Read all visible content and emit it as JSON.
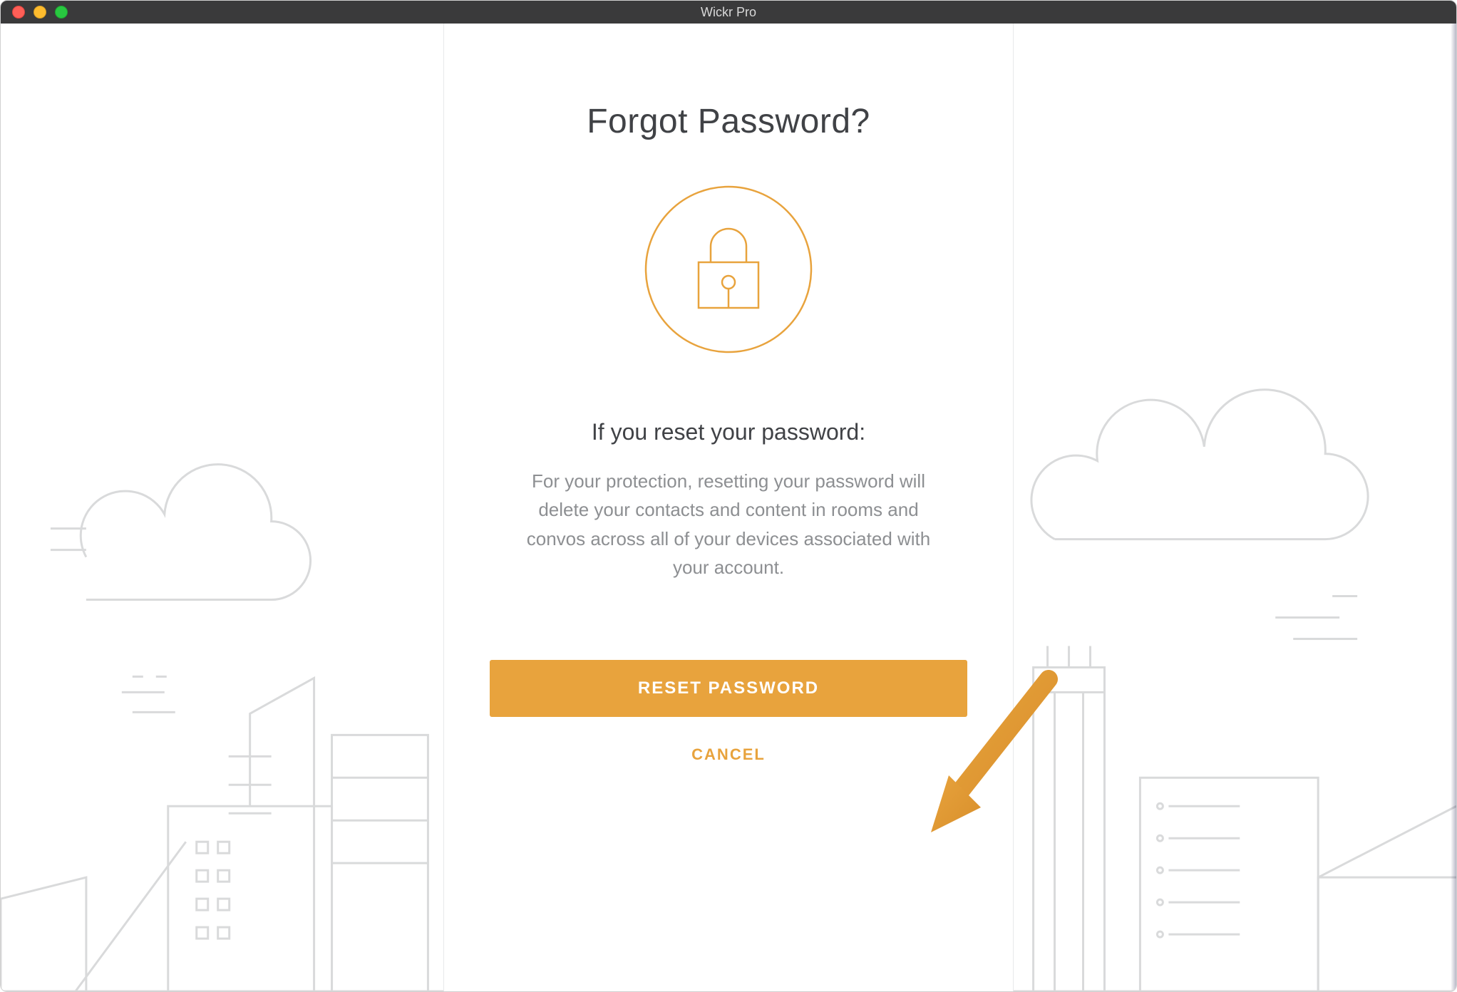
{
  "window": {
    "title": "Wickr Pro"
  },
  "dialog": {
    "heading": "Forgot Password?",
    "subheading": "If you reset your password:",
    "body": "For your protection, resetting your password will delete your contacts and content in rooms and convos across all of your devices associated with your account.",
    "reset_label": "RESET PASSWORD",
    "cancel_label": "CANCEL"
  },
  "colors": {
    "accent": "#e8a33d"
  },
  "icons": {
    "lock": "lock-icon"
  }
}
